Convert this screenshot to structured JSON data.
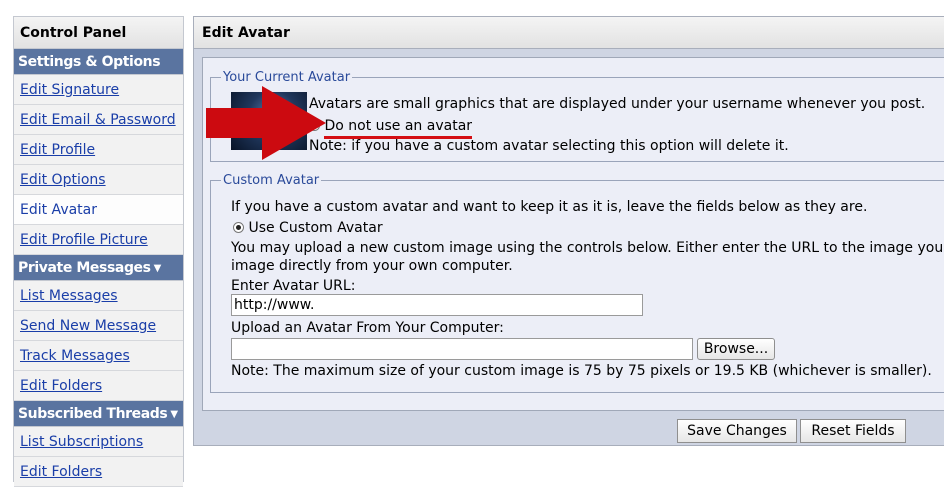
{
  "sidebar": {
    "title": "Control Panel",
    "sections": [
      {
        "heading": "Settings & Options",
        "has_caret": false,
        "items": [
          "Edit Signature",
          "Edit Email & Password",
          "Edit Profile",
          "Edit Options",
          "Edit Avatar",
          "Edit Profile Picture"
        ]
      },
      {
        "heading": "Private Messages",
        "has_caret": true,
        "items": [
          "List Messages",
          "Send New Message",
          "Track Messages",
          "Edit Folders"
        ]
      },
      {
        "heading": "Subscribed Threads",
        "has_caret": true,
        "items": [
          "List Subscriptions",
          "Edit Folders"
        ]
      }
    ],
    "active_item": "Edit Avatar"
  },
  "main": {
    "title": "Edit Avatar",
    "current_avatar": {
      "legend": "Your Current Avatar",
      "description": "Avatars are small graphics that are displayed under your username whenever you post.",
      "no_avatar_option": "Do not use an avatar",
      "note": "Note: if you have a custom avatar selecting this option will delete it."
    },
    "custom_avatar": {
      "legend": "Custom Avatar",
      "intro": "If you have a custom avatar and want to keep it as it is, leave the fields below as they are.",
      "use_custom_option": "Use Custom Avatar",
      "upload_line1": "You may upload a new custom image using the controls below. Either enter the URL to the image you",
      "upload_line2": "image directly from your own computer.",
      "url_label": "Enter Avatar URL:",
      "url_value": "http://www.",
      "upload_label": "Upload an Avatar From Your Computer:",
      "file_value": "",
      "browse_label": "Browse...",
      "size_note": "Note: The maximum size of your custom image is 75 by 75 pixels or 19.5 KB (whichever is smaller)."
    },
    "buttons": {
      "save": "Save Changes",
      "reset": "Reset Fields"
    }
  },
  "annotation": {
    "arrow_color": "#cc0a10",
    "arrow_icon": "red-arrow-icon"
  }
}
